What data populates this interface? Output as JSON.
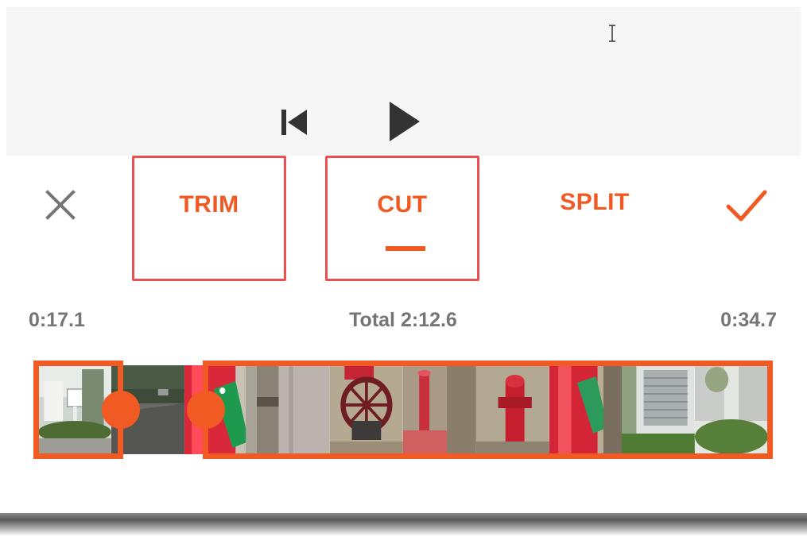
{
  "player": {
    "prev_icon": "skip-to-start-icon",
    "play_icon": "play-icon"
  },
  "toolbar": {
    "close_icon": "close-icon",
    "tabs": [
      {
        "label": "TRIM"
      },
      {
        "label": "CUT"
      },
      {
        "label": "SPLIT"
      }
    ],
    "selected_tab": "CUT",
    "confirm_icon": "checkmark-icon"
  },
  "times": {
    "start": "0:17.1",
    "total": "Total 2:12.6",
    "end": "0:34.7"
  },
  "colors": {
    "accent": "#f15a22",
    "highlight_border": "#ec4f52",
    "icon_gray": "#757575",
    "preview_bg": "#f6f6f6"
  }
}
